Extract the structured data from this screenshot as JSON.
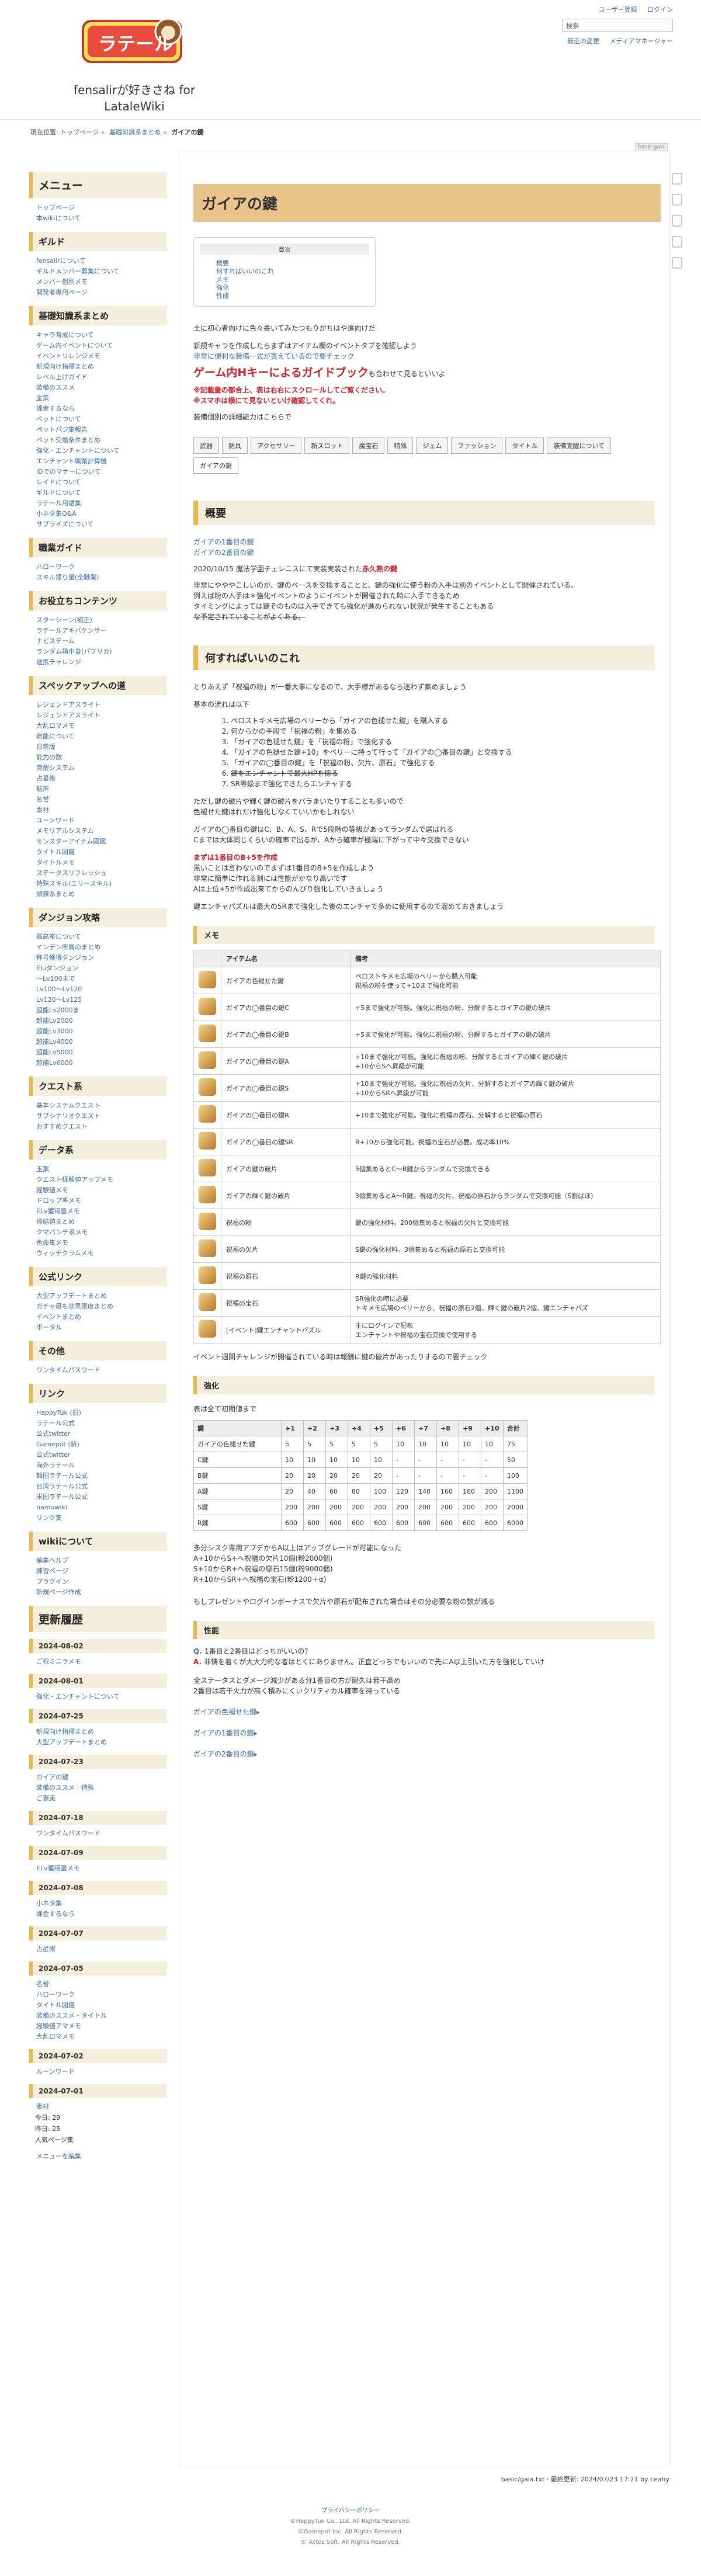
{
  "header": {
    "logo_text": "ラテール",
    "site_title": "fensalirが好きさね for LataleWiki",
    "usermenu": [
      "ユーザー登録",
      "ログイン"
    ],
    "search_placeholder": "検索",
    "links": [
      "最近の変更",
      "メディアマネージャー"
    ]
  },
  "breadcrumb": {
    "label": "現在位置:",
    "items": [
      "トップページ",
      "基礎知識系まとめ"
    ],
    "current": "ガイアの鍵"
  },
  "page_tag": "basic:gaia",
  "sidebar": {
    "menu_title": "メニュー",
    "menu_items": [
      "トップページ",
      "本wikiについて"
    ],
    "sections": [
      {
        "title": "ギルド",
        "items": [
          "fensalirについて",
          "ギルドメンバー募集について",
          "メンバー個別メモ",
          "開発者専用ページ"
        ]
      },
      {
        "title": "基礎知識系まとめ",
        "items": [
          "キャラ育成について",
          "ゲーム内イベントについて",
          "イベントリレンジメモ",
          "新規向け指標まとめ",
          "レベル上げガイド",
          "装備のススメ",
          "金策",
          "課金するなら",
          "ペットについて",
          "ペットパジ集報告",
          "ペット交換条件まとめ",
          "強化・エンチャントについて",
          "エンチャント職業計算機",
          "IDでのマナーについて",
          "レイドについて",
          "ギルドについて",
          "ラテール用語集",
          "小ネタ集Q&A",
          "サプライズについて"
        ]
      },
      {
        "title": "職業ガイド",
        "items": [
          "ハローワーク",
          "スキル振り量(全職業)"
        ]
      },
      {
        "title": "お役立ちコンテンツ",
        "items": [
          "スターシーン(補正)",
          "ラテールアキバケンサー",
          "ナビステーム",
          "ランダム箱中身(パブリカ)",
          "連携チャレンジ"
        ]
      },
      {
        "title": "スペックアップへの道",
        "items": [
          "レジェンドアスライト",
          "レジェンドアスライト",
          "大乱ロマメモ",
          "総能について",
          "日常版",
          "能力の数",
          "覚醒システム",
          "占星術",
          "転声",
          "名誉",
          "素材",
          "ユーンワード",
          "メモリアルシステム",
          "モンスターアイテム図鑑",
          "タイトル図鑑",
          "タイトルメモ",
          "ステータスリフレッシュ",
          "特殊スキル(エリースキル)",
          "頭錬系まとめ"
        ]
      },
      {
        "title": "ダンジョン攻略",
        "items": [
          "最高室について",
          "インデン所属のまとめ",
          "称号獲得ダンジョン",
          "Eluダンジョン",
          "〜Lv100まで",
          "Lv100〜Lv120",
          "Lv120〜Lv125",
          "超能Lv2000ま",
          "超能Lv2000",
          "超能Lv3000",
          "超能Lv4000",
          "超能Lv5000",
          "超能Lv6000"
        ]
      },
      {
        "title": "クエスト系",
        "items": [
          "基本システムクエスト",
          "サブシナリオクエスト",
          "おすすめクエスト"
        ]
      },
      {
        "title": "データ系",
        "items": [
          "玉薬",
          "クエスト経験値アップメモ",
          "経験値メモ",
          "ドロップ率メモ",
          "ELv獲得量メモ",
          "帰結値まとめ",
          "クマパンチ系メモ",
          "色命集メモ",
          "ウィッチクラムメモ"
        ]
      },
      {
        "title": "公式リンク",
        "items": [
          "大型アップデートまとめ",
          "ガチャ最も効果限度まとめ",
          "イベントまとめ",
          "ポータル"
        ]
      },
      {
        "title": "その他",
        "items": [
          "ワンタイムパスワード"
        ]
      },
      {
        "title": "リンク",
        "items": [
          "HappyTuk (旧)",
          "ラテール公式",
          "公式twitter",
          "Gamepot (新)",
          "公式twitter",
          "海外ラテール",
          "韓国ラテール公式",
          "台湾ラテール公式",
          "米国ラテール公式",
          "namuwiki",
          "リンク集"
        ]
      },
      {
        "title": "wikiについて",
        "items": [
          "編集ヘルプ",
          "練習ページ",
          "プラグイン",
          "新規ページ作成"
        ]
      }
    ],
    "updates_title": "更新履歴",
    "updates": [
      {
        "date": "2024-08-02",
        "items": [
          "ご祝ミニラメモ"
        ]
      },
      {
        "date": "2024-08-01",
        "items": [
          "強化・エンチャントについて"
        ]
      },
      {
        "date": "2024-07-25",
        "items": [
          "新規向け指標まとめ",
          "大型アップデートまとめ"
        ]
      },
      {
        "date": "2024-07-23",
        "items": [
          "ガイアの鍵",
          "装備のススメ｜特殊",
          "ご褒美"
        ]
      },
      {
        "date": "2024-07-18",
        "items": [
          "ワンタイムパスワード"
        ]
      },
      {
        "date": "2024-07-09",
        "items": [
          "ELv獲得量メモ"
        ]
      },
      {
        "date": "2024-07-08",
        "items": [
          "小ネタ集",
          "課金するなら"
        ]
      },
      {
        "date": "2024-07-07",
        "items": [
          "占星術"
        ]
      },
      {
        "date": "2024-07-05",
        "items": [
          "名誉",
          "ハローワーク",
          "タイトル図鑑",
          "装備のススメ・タイトル",
          "経験値アマメモ",
          "大乱ロマメモ"
        ]
      },
      {
        "date": "2024-07-02",
        "items": [
          "ルーンワード"
        ]
      },
      {
        "date": "2024-07-01",
        "items": [
          "素材"
        ]
      }
    ],
    "counter": [
      "今日: 29",
      "昨日: 25",
      "人気ページ集"
    ],
    "edit_menu": "メニューを編集"
  },
  "main": {
    "title": "ガイアの鍵",
    "toc_title": "目次",
    "toc": [
      "概要",
      "何すればいいのこれ",
      "メモ",
      "強化",
      "性能"
    ],
    "intro": [
      "土に初心者向けに色々書いてみたつもりがちはや進向けだ",
      "新規キャラを作成したらまずはアイテム欄のイベントタブを確認しよう",
      "非常に便利な装備一式が貰えているので要チェック"
    ],
    "guidebook": "ゲーム内Hキーによるガイドブック",
    "guidebook_tail": "も合わせて見るといいよ",
    "notes": [
      "※記載量の都合上、表は右右にスクロールしてご覧ください。",
      "※スマホは横にて見ないといけ確認してくれ。"
    ],
    "detail_link": "装備個別の詳細能力はこちらで",
    "tabs": [
      "武器",
      "防具",
      "アクセサリー",
      "新スロット",
      "魔宝石",
      "特殊",
      "ジェム",
      "ファッション",
      "タイトル",
      "装備覚醒について",
      "ガイアの鍵"
    ],
    "active_tab": "ガイアの鍵",
    "overview_title": "概要",
    "overview_links": [
      "ガイアの1番目の鍵",
      "ガイアの2番目の鍵"
    ],
    "overview_text": [
      "2020/10/15 魔法学園チェレニスにて実装実装された",
      "非常にやややこしいのが、鍵のベースを交換することと、鍵の強化に使う粉の入手は別のイベントとして開催されている。",
      "例えば粉の入手は＊強化イベントのようにイベントが開催された時に入手できるため",
      "タイミングによっては鍵そのものは入手できても強化が進められない状況が発生することもある",
      "な予定されていることがよくある。"
    ],
    "overview_red": "赤久熟の鍵",
    "what_title": "何すればいいのこれ",
    "what_text": [
      "とりあえず「祝福の粉」が一番大事になるので、大手様があるなら迷わず集めましょう",
      "基本の流れは以下"
    ],
    "steps": [
      "ペロストキメモ広場のベリーから「ガイアの色褪せた鍵」を購入する",
      "何からかの手段で「祝福の粉」を集める",
      "「ガイアの色褪せた鍵」を「祝福の粉」で強化する",
      "「ガイアの色褪せた鍵+10」をベリーに持って行って「ガイアの◯番目の鍵」と交換する",
      "「ガイアの◯番目の鍵」を「祝福の粉、欠片、原石」で強化する",
      "鍵をエンチャントで最大HPを稼る",
      "SR等級まで強化できたらエンチャする"
    ],
    "what_text2": [
      "ただし鍵の破片や輝く鍵の破片をパラまいたりすることも多いので",
      "色褪せた鍵はれだけ強化しなくていいかもしれない",
      "ガイアの◯番目の鍵はC、B、A、S、Rで5段階の等級があってランダムで選ばれる",
      "Cまでは大体同じくらいの確率で出るが、Aから確率が極端に下がって中々交換できない",
      "黒いことは言わないのでまずは1番目のB+5を作成しよう",
      "非常に簡単に作れる割には性能がかなり高いです",
      "Aは上位+5が作成出来てからのんびり強化していきましょう",
      "鍵エンチャパズルは最大の5Rまで強化した後のエンチャで多めに使用するので溜めておきましょう"
    ],
    "what_red": "まずは1番目のB+5を作成",
    "memo_title": "メモ",
    "memo_headers": [
      "アイテム名",
      "備考"
    ],
    "memo_rows": [
      {
        "name": "ガイアの色褪せた鍵",
        "note": "ペロストキメモ広場のベリーから購入可能\n祝福の粉を使って+10まで強化可能"
      },
      {
        "name": "ガイアの◯番目の鍵C",
        "note": "+5まで強化が可能。強化に祝福の粉、分解するとガイアの鍵の破片"
      },
      {
        "name": "ガイアの◯番目の鍵B",
        "note": "+5まで強化が可能。強化に祝福の粉、分解するとガイアの鍵の破片"
      },
      {
        "name": "ガイアの◯番目の鍵A",
        "note": "+10まで強化が可能。強化に祝福の粉、分解するとガイアの輝く鍵の破片\n+10からSへ昇級が可能"
      },
      {
        "name": "ガイアの◯番目の鍵S",
        "note": "+10まで強化が可能。強化に祝福の欠片、分解するとガイアの輝く鍵の破片\n+10からSRへ昇級が可能"
      },
      {
        "name": "ガイアの◯番目の鍵R",
        "note": "+10まで強化が可能。強化に祝福の原石、分解すると祝福の原石"
      },
      {
        "name": "ガイアの◯番目の鍵SR",
        "note": "R+10から強化可能。祝福の宝石が必要。成功率10%"
      },
      {
        "name": "ガイアの鍵の破片",
        "note": "5個集めるとC〜B鍵からランダムで交換できる"
      },
      {
        "name": "ガイアの輝く鍵の破片",
        "note": "3個集めるとA〜R鍵。祝福の欠片、祝福の原石からランダムで交換可能（S割はほ）"
      },
      {
        "name": "祝福の粉",
        "note": "鍵の強化材料。200個集めると祝福の欠片と交換可能"
      },
      {
        "name": "祝福の欠片",
        "note": "S鍵の強化材料。3個集めると祝福の原石と交換可能"
      },
      {
        "name": "祝福の原石",
        "note": "R鍵の強化材料"
      },
      {
        "name": "祝福の宝石",
        "note": "SR強化の時に必要\nトキメモ広場のベリーから、祝福の原石2個、輝く鍵の破片2個、鍵エンチャパズ"
      },
      {
        "name": "[イベント]鍵エンチャントパズル",
        "note": "主にログインで配布\nエンチャントや祝福の宝石交換で使用する"
      }
    ],
    "memo_after": "イベント週間チャレンジが開催されている時は報酬に鍵の破片があったりするので要チェック",
    "enhance_title": "強化",
    "enhance_intro": "表は全て初期値まで",
    "enhance_headers": [
      "鍵",
      "+1",
      "+2",
      "+3",
      "+4",
      "+5",
      "+6",
      "+7",
      "+8",
      "+9",
      "+10",
      "合計"
    ],
    "enhance_rows": [
      [
        "ガイアの色褪せた鍵",
        "5",
        "5",
        "5",
        "5",
        "5",
        "10",
        "10",
        "10",
        "10",
        "10",
        "75"
      ],
      [
        "C鍵",
        "10",
        "10",
        "10",
        "10",
        "10",
        "-",
        "-",
        "-",
        "-",
        "-",
        "50"
      ],
      [
        "B鍵",
        "20",
        "20",
        "20",
        "20",
        "20",
        "-",
        "-",
        "-",
        "-",
        "-",
        "100"
      ],
      [
        "A鍵",
        "20",
        "40",
        "60",
        "80",
        "100",
        "120",
        "140",
        "160",
        "180",
        "200",
        "1100"
      ],
      [
        "S鍵",
        "200",
        "200",
        "200",
        "200",
        "200",
        "200",
        "200",
        "200",
        "200",
        "200",
        "2000"
      ],
      [
        "R鍵",
        "600",
        "600",
        "600",
        "600",
        "600",
        "600",
        "600",
        "600",
        "600",
        "600",
        "6000"
      ]
    ],
    "enhance_notes": [
      "多分シスク専用アプデからA以上はアップグレードが可能になった",
      "A+10からS+へ祝福の欠片10個(粉2000個)",
      "S+10からR+へ祝福の原石15個(粉9000個)",
      "R+10からSR+へ祝福の宝石(粉1200＋α)",
      "もしプレゼントやログインボーナスで欠片や原石が配布された場合はその分必要な粉の数が減る"
    ],
    "perf_title": "性能",
    "perf_q": "1番目と2番目はどっちがいいの？",
    "perf_a": "非情を着くが大大力的な者はとくにありません。正直どっちでもいいので先にA以上引いた方を強化していけ",
    "perf_notes": [
      "全ステータスとダメージ減少がある分1番目の方が耐久は若干高め",
      "2番目は若干火力が高く積みにくいクリティカル確率を持っている"
    ],
    "perf_links": [
      "ガイアの色褪せた鍵▸",
      "ガイアの1番目の鍵▸",
      "ガイアの2番目の鍵▸"
    ]
  },
  "page_footer": "basic/gaia.txt · 最終更新: 2024/07/23 17:21 by ceahy",
  "footer": [
    "プライバシーポリシー",
    "©HappyTuk Co., Ltd. All Rights Reserved.",
    "©Gamepot Inc. All Rights Reserved.",
    "© Actoz Soft. All Rights Reserved."
  ]
}
